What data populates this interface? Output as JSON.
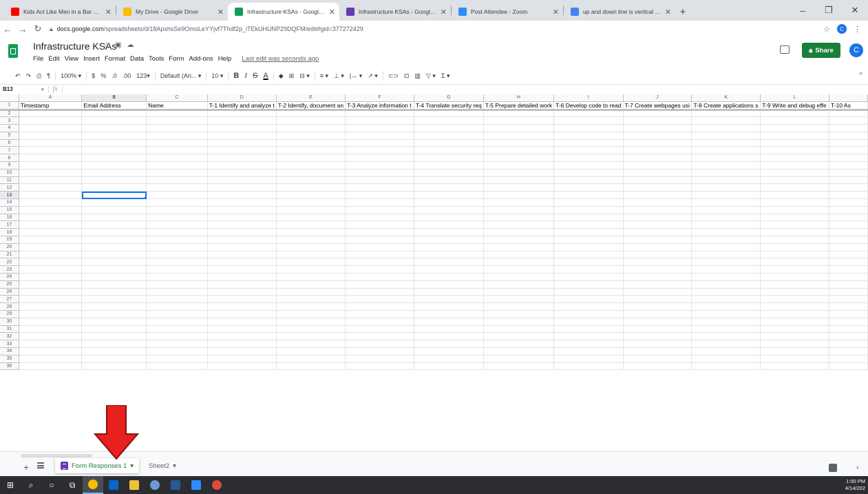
{
  "browser": {
    "tabs": [
      {
        "title": "Kids Act Like Men in a Bar Fight |",
        "favicon": "youtube-icon",
        "color": "#ff0000",
        "active": false
      },
      {
        "title": "My Drive - Google Drive",
        "favicon": "drive-icon",
        "color": "#fbbc04",
        "active": false
      },
      {
        "title": "Infrastructure KSAs - Google She",
        "favicon": "sheets-icon",
        "color": "#0f9d58",
        "active": true
      },
      {
        "title": "Infrastructure KSAs - Google For",
        "favicon": "forms-icon",
        "color": "#673ab7",
        "active": false
      },
      {
        "title": "Post Attendee - Zoom",
        "favicon": "zoom-icon",
        "color": "#2d8cff",
        "active": false
      },
      {
        "title": "up and down line is veritcal or ho",
        "favicon": "google-icon",
        "color": "#4285f4",
        "active": false
      }
    ],
    "url_host": "docs.google.com",
    "url_path": "/spreadsheets/d/18ApxhsSe9OmoLeYYjvf7Thdf2p_iTEkUHUNP29DQFM/edit#gid=377272429",
    "profile_initial": "C"
  },
  "doc": {
    "title": "Infrastructure KSAs",
    "menus": [
      "File",
      "Edit",
      "View",
      "Insert",
      "Format",
      "Data",
      "Tools",
      "Form",
      "Add-ons",
      "Help"
    ],
    "last_edit": "Last edit was seconds ago",
    "share_label": "Share",
    "user_initial": "C"
  },
  "toolbar": {
    "zoom": "100%",
    "currency": "$",
    "percent": "%",
    "decimal_less": ".0",
    "decimal_more": ".00",
    "number_format": "123",
    "font": "Default (Ari...",
    "font_size": "10",
    "bold": "B",
    "italic": "I",
    "strike": "S",
    "text_color": "A",
    "sum": "Σ"
  },
  "formula_bar": {
    "cell_ref": "B13",
    "fx": "fx",
    "content": ""
  },
  "grid": {
    "columns": [
      "A",
      "B",
      "C",
      "D",
      "E",
      "F",
      "G",
      "H",
      "I",
      "J",
      "K",
      "L",
      ""
    ],
    "headers": [
      "Timestamp",
      "Email Address",
      "Name",
      "T-1 Identify and analyze t",
      "T-2 Identify, document an",
      "T-3 Analyze information t",
      "T-4 Translate security req",
      "T-5 Prepare detailed work",
      "T-6 Develop code to read",
      "T-7 Create webpages usi",
      "T-8 Create applications s",
      "T-9 Write and debug effe",
      "T-10 As"
    ],
    "row_count": 36,
    "selected_cell": "B13"
  },
  "sheets": {
    "tabs": [
      {
        "label": "Form Responses 1",
        "active": true
      },
      {
        "label": "Sheet2",
        "active": false
      }
    ]
  },
  "annotation": {
    "arrow_color": "#e8201e"
  },
  "taskbar": {
    "time": "1:00 PM",
    "date": "4/14/202"
  }
}
